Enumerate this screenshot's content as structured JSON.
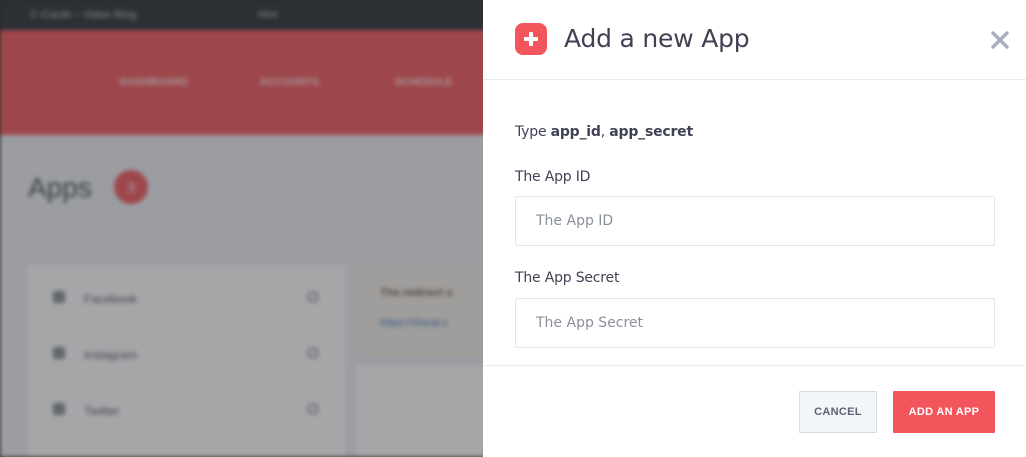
{
  "background": {
    "topbar": {
      "site_name": "C-Cards – Video Blog",
      "items": [
        "Hint"
      ]
    },
    "nav": [
      "DASHBOARD",
      "ACCOUNTS",
      "SCHEDULE"
    ],
    "page_title": "Apps",
    "app_count": "3",
    "apps_list": [
      "Facebook",
      "Instagram",
      "Twitter"
    ],
    "notice": {
      "text": "The redirect u",
      "link": "https://rlocal.c"
    }
  },
  "modal": {
    "title": "Add a new App",
    "icon": "plus-icon",
    "close_icon": "close-icon",
    "hint_prefix": "Type ",
    "hint_field1": "app_id",
    "hint_sep": ", ",
    "hint_field2": "app_secret",
    "fields": [
      {
        "label": "The App ID",
        "placeholder": "The App ID",
        "value": ""
      },
      {
        "label": "The App Secret",
        "placeholder": "The App Secret",
        "value": ""
      }
    ],
    "buttons": {
      "cancel": "CANCEL",
      "add": "ADD AN APP"
    }
  },
  "colors": {
    "accent": "#f2555b",
    "text": "#3f4254",
    "border": "#e4e6ef"
  }
}
